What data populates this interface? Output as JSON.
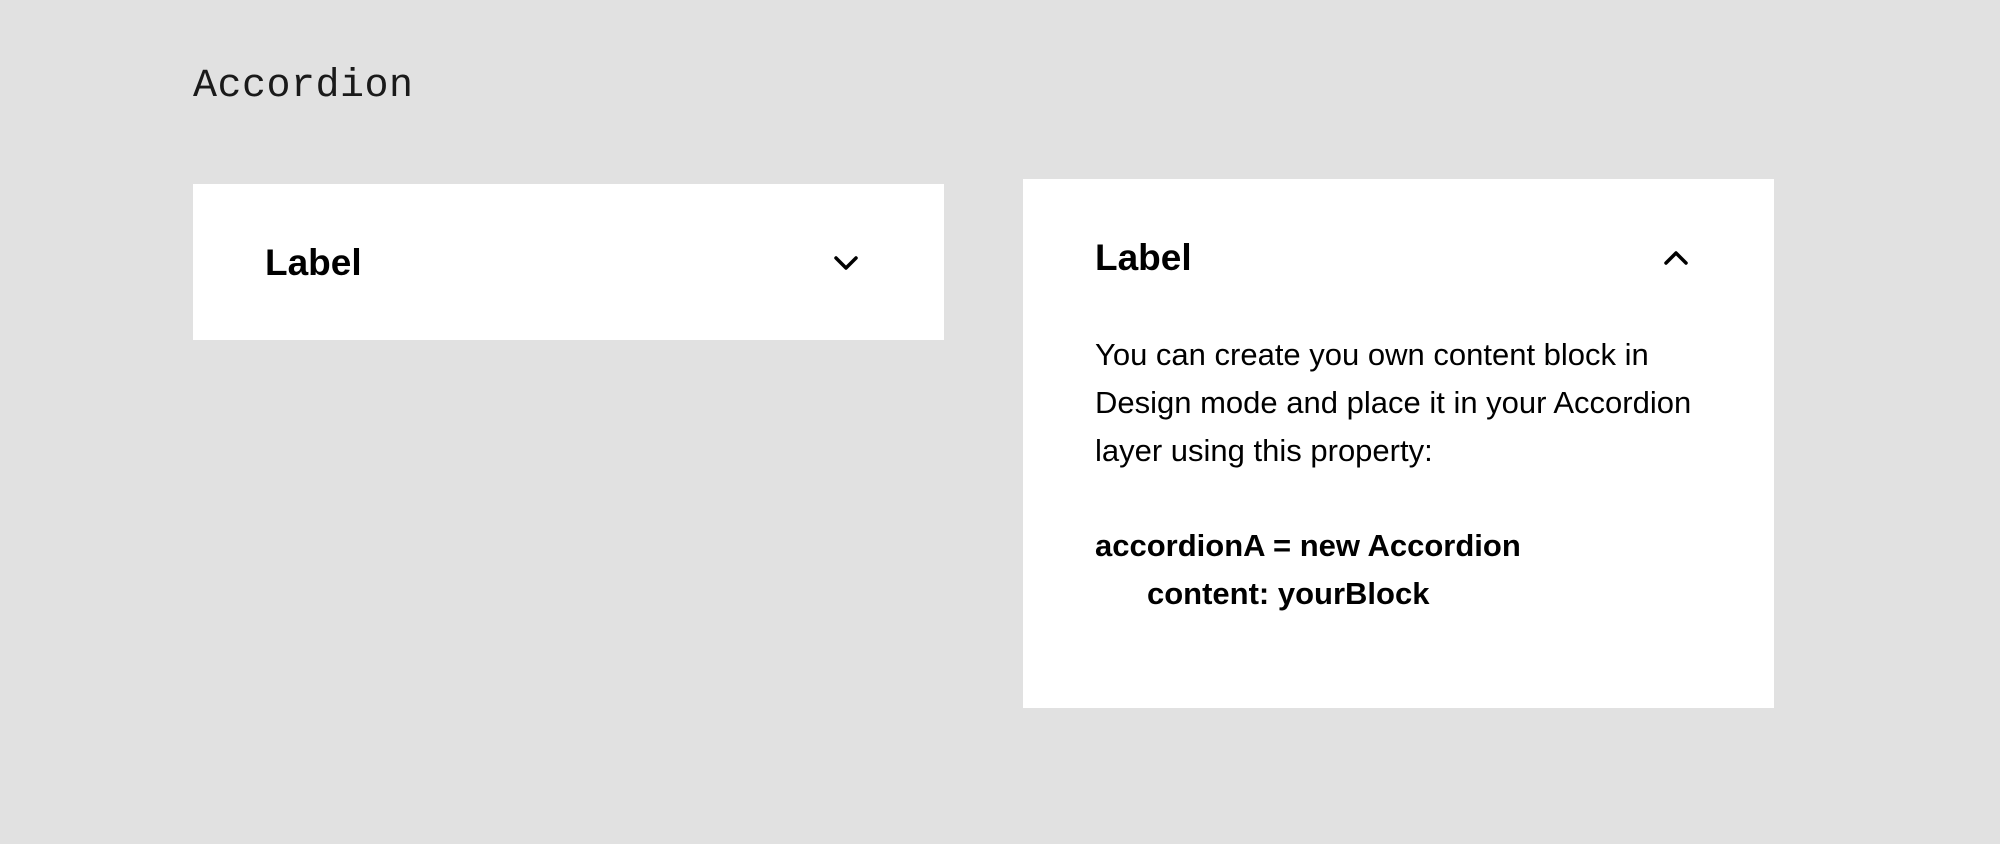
{
  "page": {
    "title": "Accordion"
  },
  "accordions": [
    {
      "state": "collapsed",
      "label": "Label",
      "icon": "chevron-down-icon"
    },
    {
      "state": "expanded",
      "label": "Label",
      "icon": "chevron-up-icon",
      "content_text": "You can create you own content block in Design mode and place it in your Accordion layer using this property:",
      "code_line_1": "accordionA = new Accordion",
      "code_line_2": "content: yourBlock"
    }
  ],
  "colors": {
    "background": "#e1e1e1",
    "panel": "#ffffff",
    "text": "#000000"
  }
}
